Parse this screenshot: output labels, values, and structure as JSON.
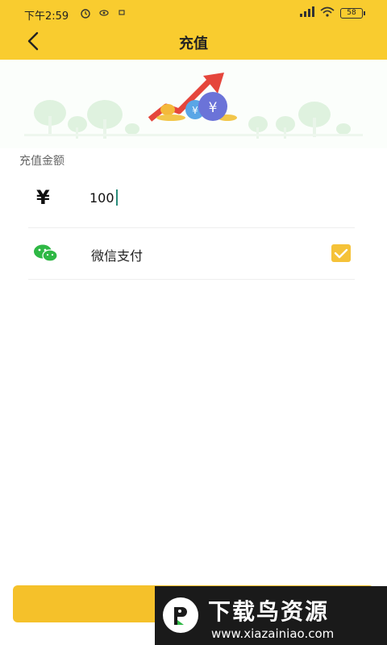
{
  "status_bar": {
    "time": "下午2:59",
    "battery": "58"
  },
  "header": {
    "title": "充值"
  },
  "recharge": {
    "section_label": "充值金额",
    "currency_symbol": "¥",
    "amount_value": "100"
  },
  "payment": {
    "method_label": "微信支付",
    "selected": true
  },
  "watermark": {
    "title": "下载鸟资源",
    "url": "www.xiazainiao.com"
  },
  "colors": {
    "header_bg": "#f9cc2f",
    "accent": "#f5c238",
    "wechat_green": "#2fb845"
  }
}
